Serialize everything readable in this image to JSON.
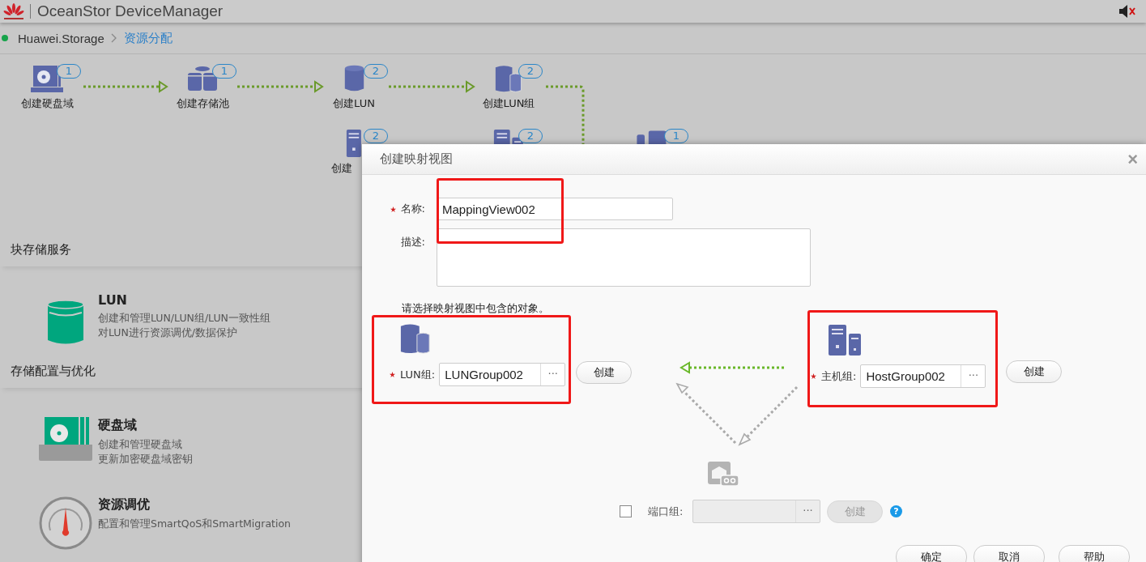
{
  "app": {
    "title": "OceanStor DeviceManager"
  },
  "breadcrumb": [
    {
      "label": "Huawei.Storage",
      "selected": false
    },
    {
      "label": "资源分配",
      "selected": true
    }
  ],
  "flow": {
    "steps": [
      {
        "kind": "disk-domain",
        "label": "创建硬盘域",
        "count": "1"
      },
      {
        "kind": "pool",
        "label": "创建存储池",
        "count": "1"
      },
      {
        "kind": "lun",
        "label": "创建LUN",
        "count": "2"
      },
      {
        "kind": "lun-group",
        "label": "创建LUN组",
        "count": "2"
      }
    ],
    "second_row": [
      {
        "kind": "host",
        "label": "创建",
        "count": "2"
      },
      {
        "kind": "host-group",
        "count": "2"
      },
      {
        "kind": "mapping",
        "count": "1"
      }
    ]
  },
  "sections": [
    {
      "title": "块存储服务",
      "items": [
        {
          "kind": "lun",
          "title": "LUN",
          "lines": [
            "创建和管理LUN/LUN组/LUN一致性组",
            "对LUN进行资源调优/数据保护"
          ]
        }
      ]
    },
    {
      "title": "存储配置与优化",
      "items": [
        {
          "kind": "disk-domain",
          "title": "硬盘域",
          "lines": [
            "创建和管理硬盘域",
            "更新加密硬盘域密钥"
          ]
        },
        {
          "kind": "tuning",
          "title": "资源调优",
          "lines": [
            "配置和管理SmartQoS和SmartMigration"
          ]
        }
      ]
    }
  ],
  "dialog": {
    "title": "创建映射视图",
    "close": "×",
    "name": {
      "label": "名称:",
      "required": true,
      "value": "MappingView002",
      "highlighted": true
    },
    "description": {
      "label": "描述:",
      "required": false
    },
    "hint": "请选择映射视图中包含的对象。",
    "objects": [
      {
        "kind": "lun-group",
        "label": "LUN组:",
        "required": true,
        "value": "LUNGroup002",
        "browse": "···",
        "button": "创建",
        "highlighted": true
      },
      {
        "kind": "host-group",
        "label": "主机组:",
        "required": true,
        "value": "HostGroup002",
        "browse": "···",
        "button": "创建",
        "highlighted": true
      }
    ],
    "port_group": {
      "label": "端口组:",
      "checked": false,
      "disabled": true,
      "browse": "···",
      "button": "创建",
      "help": "?"
    },
    "buttons": [
      "确定",
      "取消",
      "帮助"
    ]
  }
}
